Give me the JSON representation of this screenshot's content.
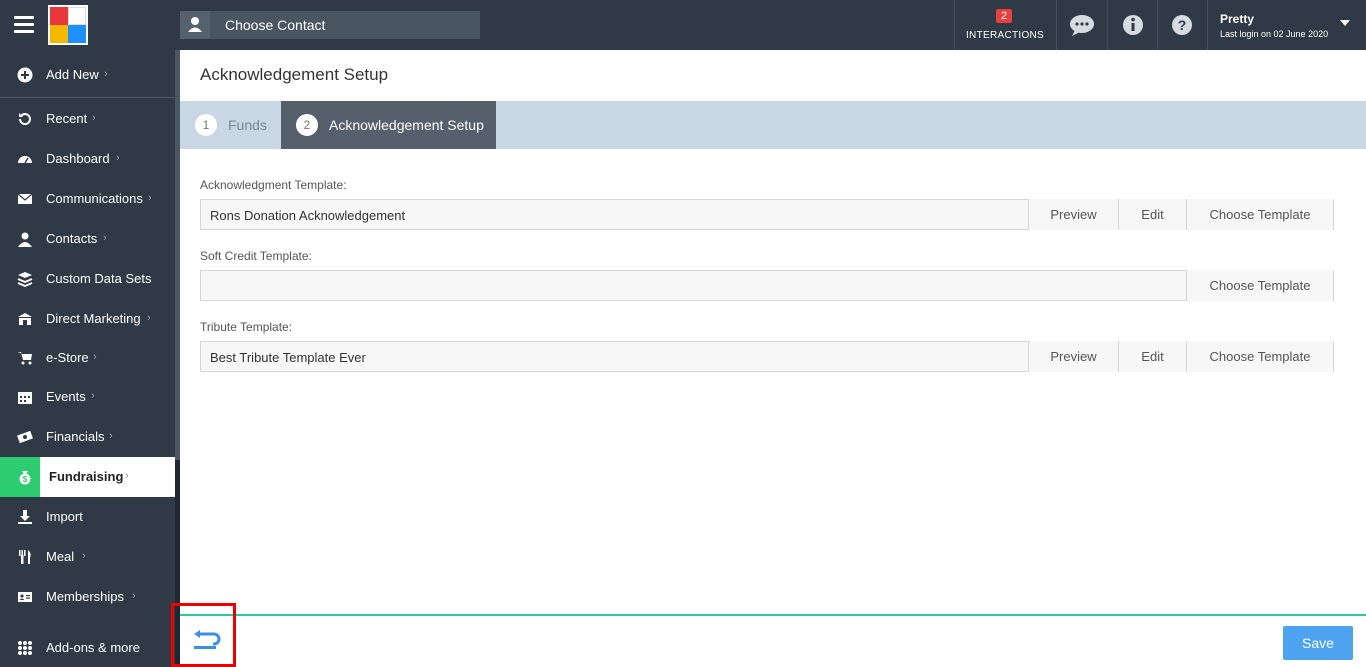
{
  "topbar": {
    "contact_placeholder": "Choose Contact",
    "interactions_count": "2",
    "interactions_label": "INTERACTIONS",
    "user_name": "Pretty",
    "last_login": "Last login on 02 June 2020"
  },
  "sidebar": {
    "items": [
      {
        "label": "Add New",
        "icon": "plus-circle-icon"
      },
      {
        "label": "Recent",
        "icon": "history-icon"
      },
      {
        "label": "Dashboard",
        "icon": "dashboard-icon"
      },
      {
        "label": "Communications",
        "icon": "envelope-icon"
      },
      {
        "label": "Contacts",
        "icon": "user-icon"
      },
      {
        "label": "Custom Data Sets",
        "icon": "layers-icon"
      },
      {
        "label": "Direct Marketing",
        "icon": "building-icon"
      },
      {
        "label": "e-Store",
        "icon": "cart-icon"
      },
      {
        "label": "Events",
        "icon": "calendar-icon"
      },
      {
        "label": "Financials",
        "icon": "money-icon"
      },
      {
        "label": "Fundraising",
        "icon": "money-bag-icon"
      },
      {
        "label": "Import",
        "icon": "download-icon"
      },
      {
        "label": "Meal",
        "icon": "utensils-icon"
      },
      {
        "label": "Memberships",
        "icon": "id-card-icon"
      },
      {
        "label": "Add-ons & more",
        "icon": "grid-icon"
      }
    ]
  },
  "page": {
    "title": "Acknowledgement Setup",
    "steps": [
      {
        "num": "1",
        "label": "Funds"
      },
      {
        "num": "2",
        "label": "Acknowledgement Setup"
      }
    ]
  },
  "fields": {
    "ack": {
      "label": "Acknowledgment Template:",
      "value": "Rons Donation Acknowledgement"
    },
    "soft": {
      "label": "Soft Credit Template:",
      "value": ""
    },
    "tribute": {
      "label": "Tribute Template:",
      "value": "Best Tribute Template Ever"
    }
  },
  "buttons": {
    "preview": "Preview",
    "edit": "Edit",
    "choose": "Choose Template",
    "save": "Save"
  },
  "colors": {
    "sidebar_bg": "#2f3a46",
    "active_accent": "#2ecc71",
    "save_button": "#4da3ef",
    "highlight_box": "#ee0000"
  }
}
